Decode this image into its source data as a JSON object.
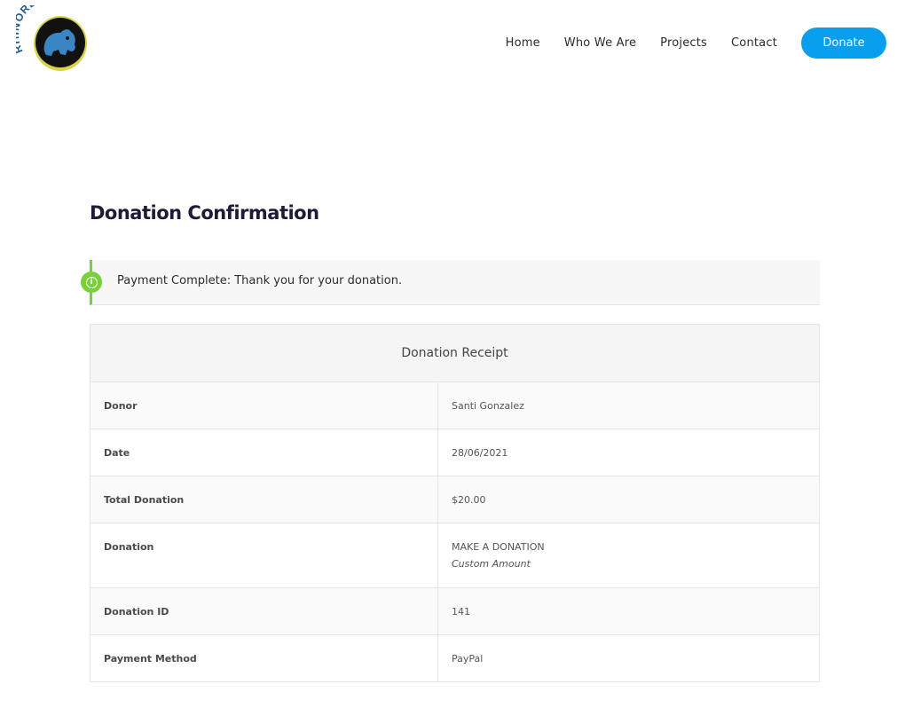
{
  "logo": {
    "text": "RHINOREPRO"
  },
  "nav": {
    "items": [
      "Home",
      "Who We Are",
      "Projects",
      "Contact"
    ],
    "donate_label": "Donate"
  },
  "page": {
    "title": "Donation Confirmation"
  },
  "notice": {
    "text": "Payment Complete: Thank you for your donation."
  },
  "receipt": {
    "heading": "Donation Receipt",
    "rows": {
      "donor": {
        "label": "Donor",
        "value": "Santi Gonzalez"
      },
      "date": {
        "label": "Date",
        "value": "28/06/2021"
      },
      "total": {
        "label": "Total Donation",
        "value": "$20.00"
      },
      "donation": {
        "label": "Donation",
        "value": "MAKE A DONATION",
        "sub": "Custom Amount"
      },
      "donation_id": {
        "label": "Donation ID",
        "value": "141"
      },
      "payment_method": {
        "label": "Payment Method",
        "value": "PayPal"
      }
    }
  },
  "colors": {
    "accent": "#079eed",
    "success": "#7ad03a",
    "title": "#1d1b35"
  }
}
